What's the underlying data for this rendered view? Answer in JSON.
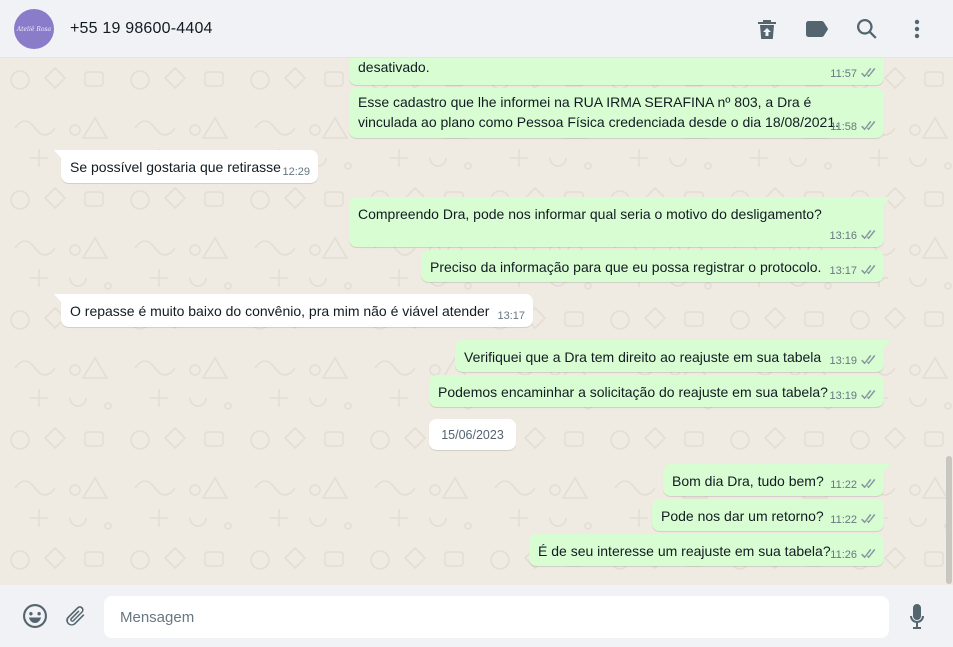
{
  "header": {
    "contact_name": "+55 19 98600-4404",
    "avatar_text": "Ateliê Rosa",
    "icons": [
      "delete-icon",
      "label-icon",
      "search-icon",
      "more-vertical-icon"
    ]
  },
  "colors": {
    "outgoing_bubble": "#d9fdd3",
    "incoming_bubble": "#ffffff",
    "chat_background": "#efeae2",
    "header_footer": "#f0f2f5",
    "icon": "#54656f",
    "timestamp": "#667781"
  },
  "messages": [
    {
      "dir": "out",
      "text": "desativado.",
      "time": "11:57",
      "status": "read"
    },
    {
      "dir": "out",
      "text": "Esse cadastro que lhe informei na RUA IRMA SERAFINA nº 803, a Dra é vinculada ao plano como Pessoa Física credenciada desde o dia 18/08/2021.",
      "time": "11:58",
      "status": "read"
    },
    {
      "dir": "in",
      "text": "Se possível gostaria que retirasse",
      "time": "12:29"
    },
    {
      "dir": "out",
      "text": "Compreendo Dra, pode nos informar qual seria o motivo do desligamento?",
      "time": "13:16",
      "status": "read"
    },
    {
      "dir": "out",
      "text": "Preciso da informação para que eu possa registrar o protocolo.",
      "time": "13:17",
      "status": "read"
    },
    {
      "dir": "in",
      "text": "O repasse é muito baixo do convênio, pra mim não é viável atender",
      "time": "13:17"
    },
    {
      "dir": "out",
      "text": "Verifiquei que a Dra tem direito ao reajuste em sua tabela",
      "time": "13:19",
      "status": "read"
    },
    {
      "dir": "out",
      "text": "Podemos encaminhar a solicitação do reajuste em sua tabela?",
      "time": "13:19",
      "status": "read"
    },
    {
      "dir": "out",
      "text": "Bom dia Dra, tudo bem?",
      "time": "11:22",
      "status": "read"
    },
    {
      "dir": "out",
      "text": "Pode nos dar um retorno?",
      "time": "11:22",
      "status": "read"
    },
    {
      "dir": "out",
      "text": "É de seu interesse um reajuste em sua tabela?",
      "time": "11:26",
      "status": "read"
    }
  ],
  "date_separator": "15/06/2023",
  "composer": {
    "placeholder": "Mensagem",
    "value": "",
    "icons": [
      "emoji-icon",
      "attach-icon",
      "microphone-icon"
    ]
  }
}
